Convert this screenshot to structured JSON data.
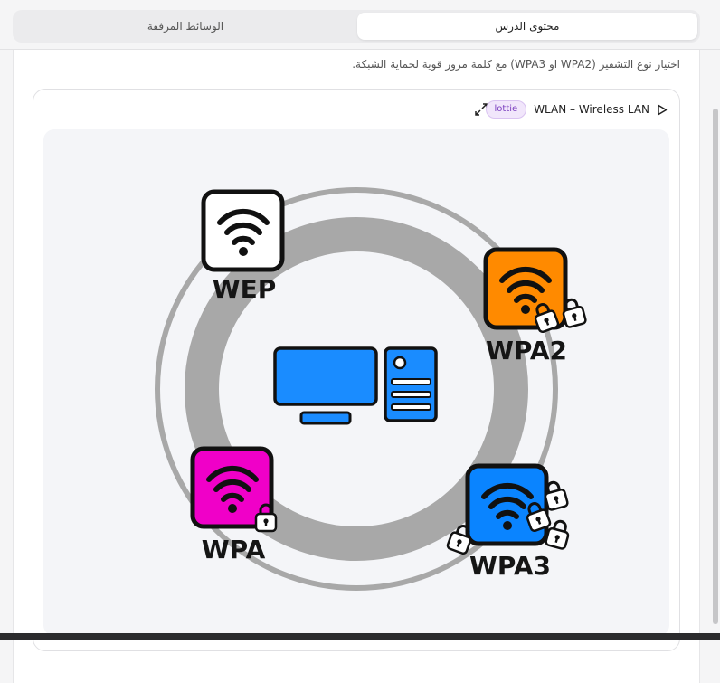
{
  "tabs": {
    "content_label": "محتوى الدرس",
    "media_label": "الوسائط المرفقة"
  },
  "intro_text": "اختيار نوع التشفير (WPA2 او WPA3) مع كلمة مرور قوية لحماية الشبكة.",
  "player": {
    "title": "WLAN – Wireless LAN",
    "badge": "lottie",
    "play_icon": "play-icon",
    "expand_icon": "expand-icon"
  },
  "animation": {
    "labels": {
      "wep": "WEP",
      "wpa": "WPA",
      "wpa2": "WPA2",
      "wpa3": "WPA3"
    },
    "colors": {
      "wep": "#ffffff",
      "wpa": "#f000c8",
      "wpa2": "#ff8a00",
      "wpa3": "#0a84ff",
      "computer": "#1a8cff",
      "ring": "#a8a8a8",
      "stage_bg": "#f4f5f8"
    }
  }
}
